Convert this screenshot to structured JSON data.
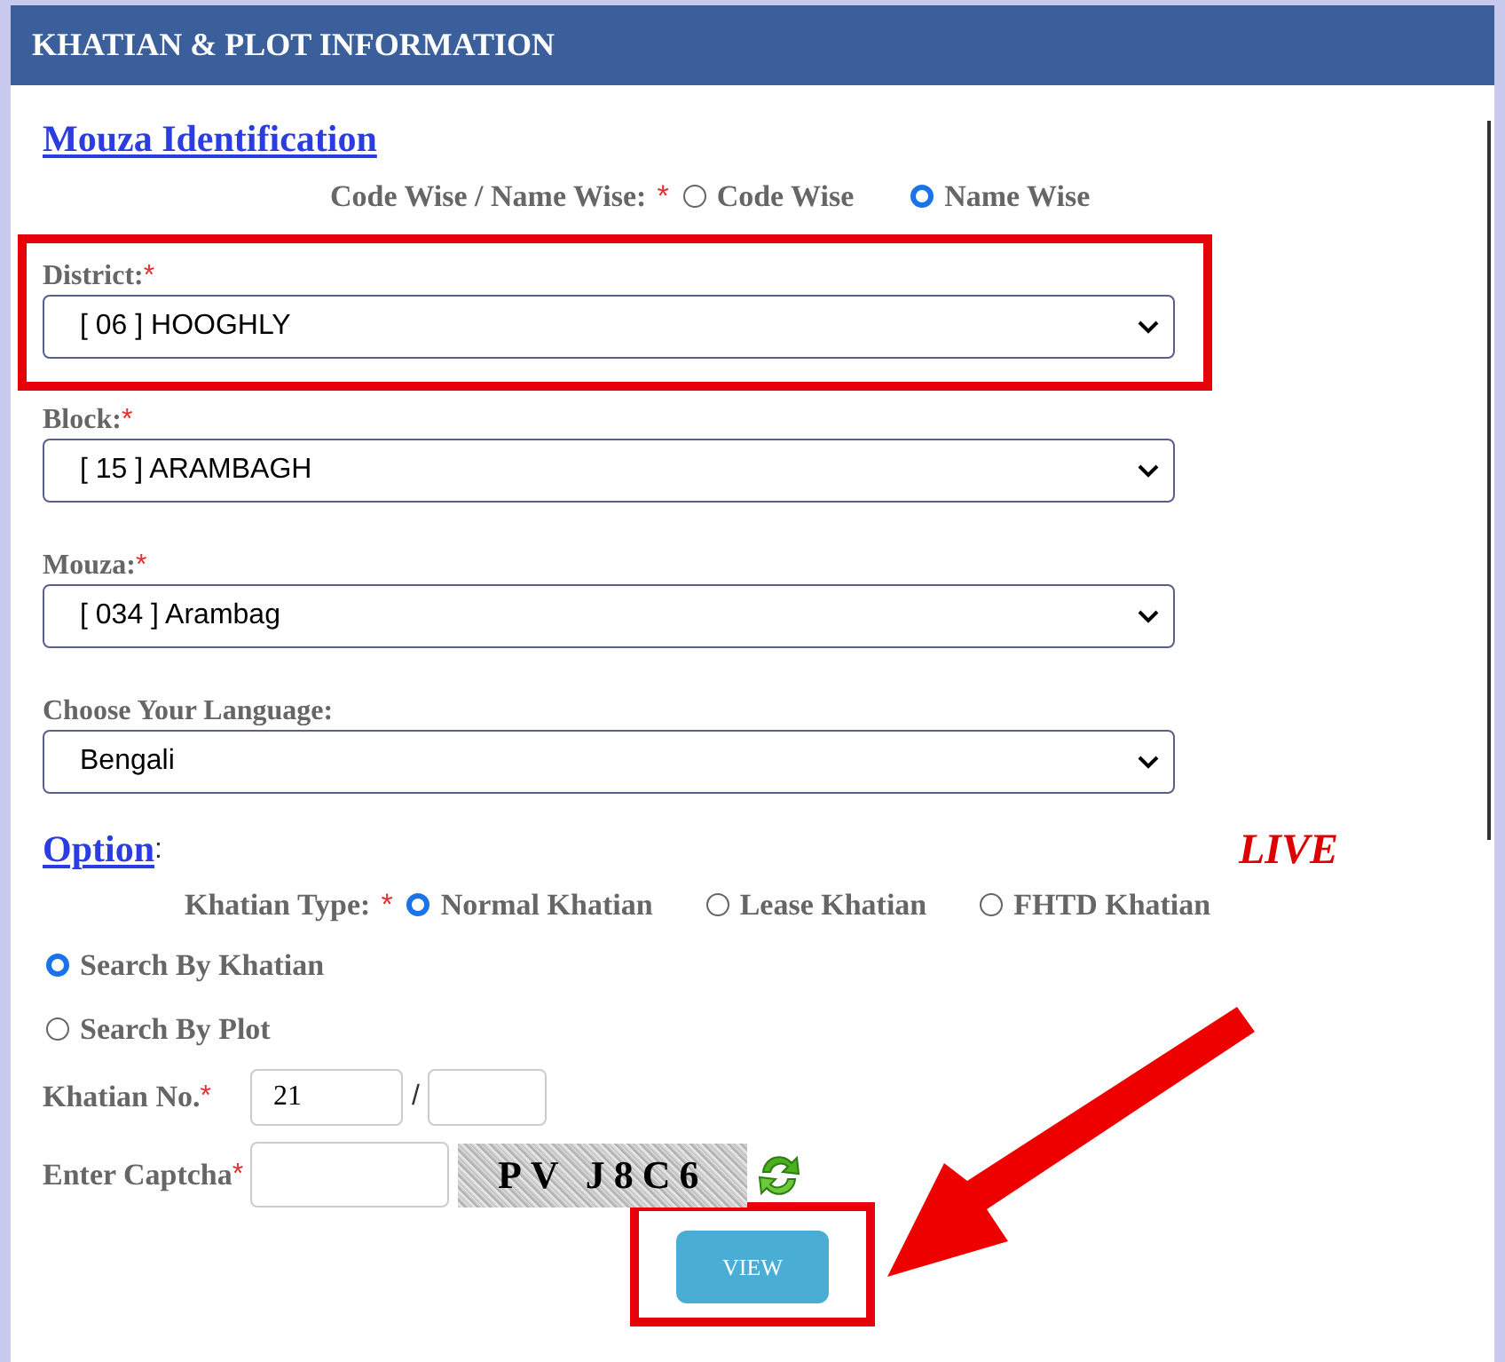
{
  "header": {
    "title": "KHATIAN & PLOT INFORMATION"
  },
  "mouza": {
    "heading": "Mouza Identification",
    "mode": {
      "label": "Code Wise / Name Wise:",
      "required": "*",
      "options": [
        {
          "label": "Code Wise",
          "selected": false
        },
        {
          "label": "Name Wise",
          "selected": true
        }
      ]
    },
    "selects": [
      {
        "label": "District:",
        "required": "*",
        "value": "[ 06 ] HOOGHLY",
        "highlighted": true
      },
      {
        "label": "Block:",
        "required": "*",
        "value": "[ 15 ] ARAMBAGH",
        "highlighted": false
      },
      {
        "label": "Mouza:",
        "required": "*",
        "value": "[ 034 ] Arambag",
        "highlighted": false
      },
      {
        "label": "Choose Your Language:",
        "value": "Bengali",
        "highlighted": false
      }
    ]
  },
  "option": {
    "heading": "Option",
    "colon": ":",
    "live": "LIVE",
    "khatian_type": {
      "label": "Khatian Type:",
      "required": "*",
      "options": [
        {
          "label": "Normal Khatian",
          "selected": true
        },
        {
          "label": "Lease Khatian",
          "selected": false
        },
        {
          "label": "FHTD Khatian",
          "selected": false
        }
      ]
    },
    "search_by": [
      {
        "label": "Search By Khatian",
        "selected": true
      },
      {
        "label": "Search By Plot",
        "selected": false
      }
    ],
    "khatian_no": {
      "label": "Khatian No.",
      "required": "*",
      "value": "21",
      "separator": "/"
    },
    "captcha": {
      "label": "Enter Captcha",
      "required": "*",
      "code": "PV J8C6"
    },
    "view_button": {
      "label": "VIEW",
      "highlighted": true
    }
  }
}
